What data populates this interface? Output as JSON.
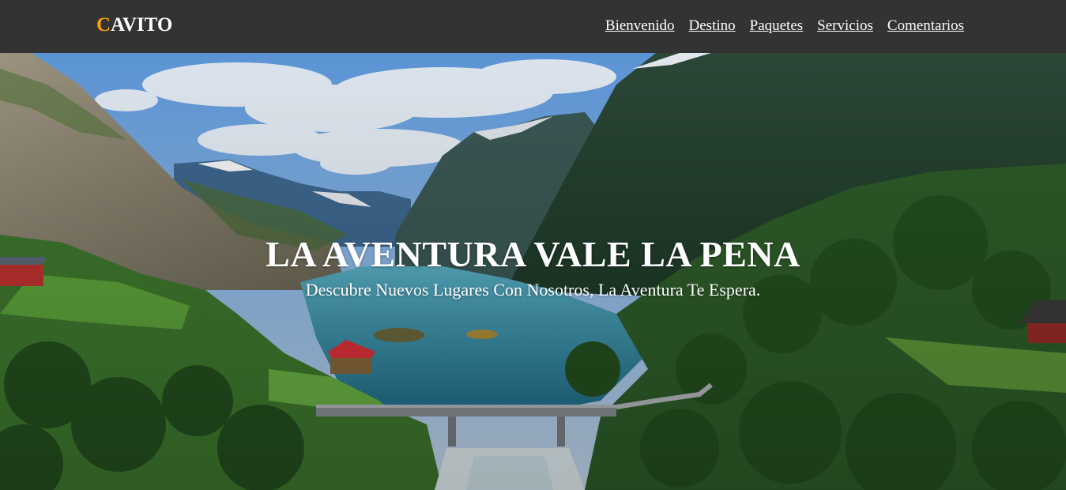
{
  "brand": {
    "first_letter": "C",
    "rest": "AVITO",
    "accent_color": "#f5a300"
  },
  "nav": {
    "items": [
      {
        "label": "Bienvenido"
      },
      {
        "label": "Destino"
      },
      {
        "label": "Paquetes"
      },
      {
        "label": "Servicios"
      },
      {
        "label": "Comentarios"
      }
    ]
  },
  "hero": {
    "title": "LA AVENTURA VALE LA PENA",
    "subtitle": "Descubre Nuevos Lugares Con Nosotros, La Aventura Te Espera.",
    "image": "mountain-fjord-landscape"
  },
  "colors": {
    "header_bg": "#333333",
    "text": "#ffffff"
  }
}
